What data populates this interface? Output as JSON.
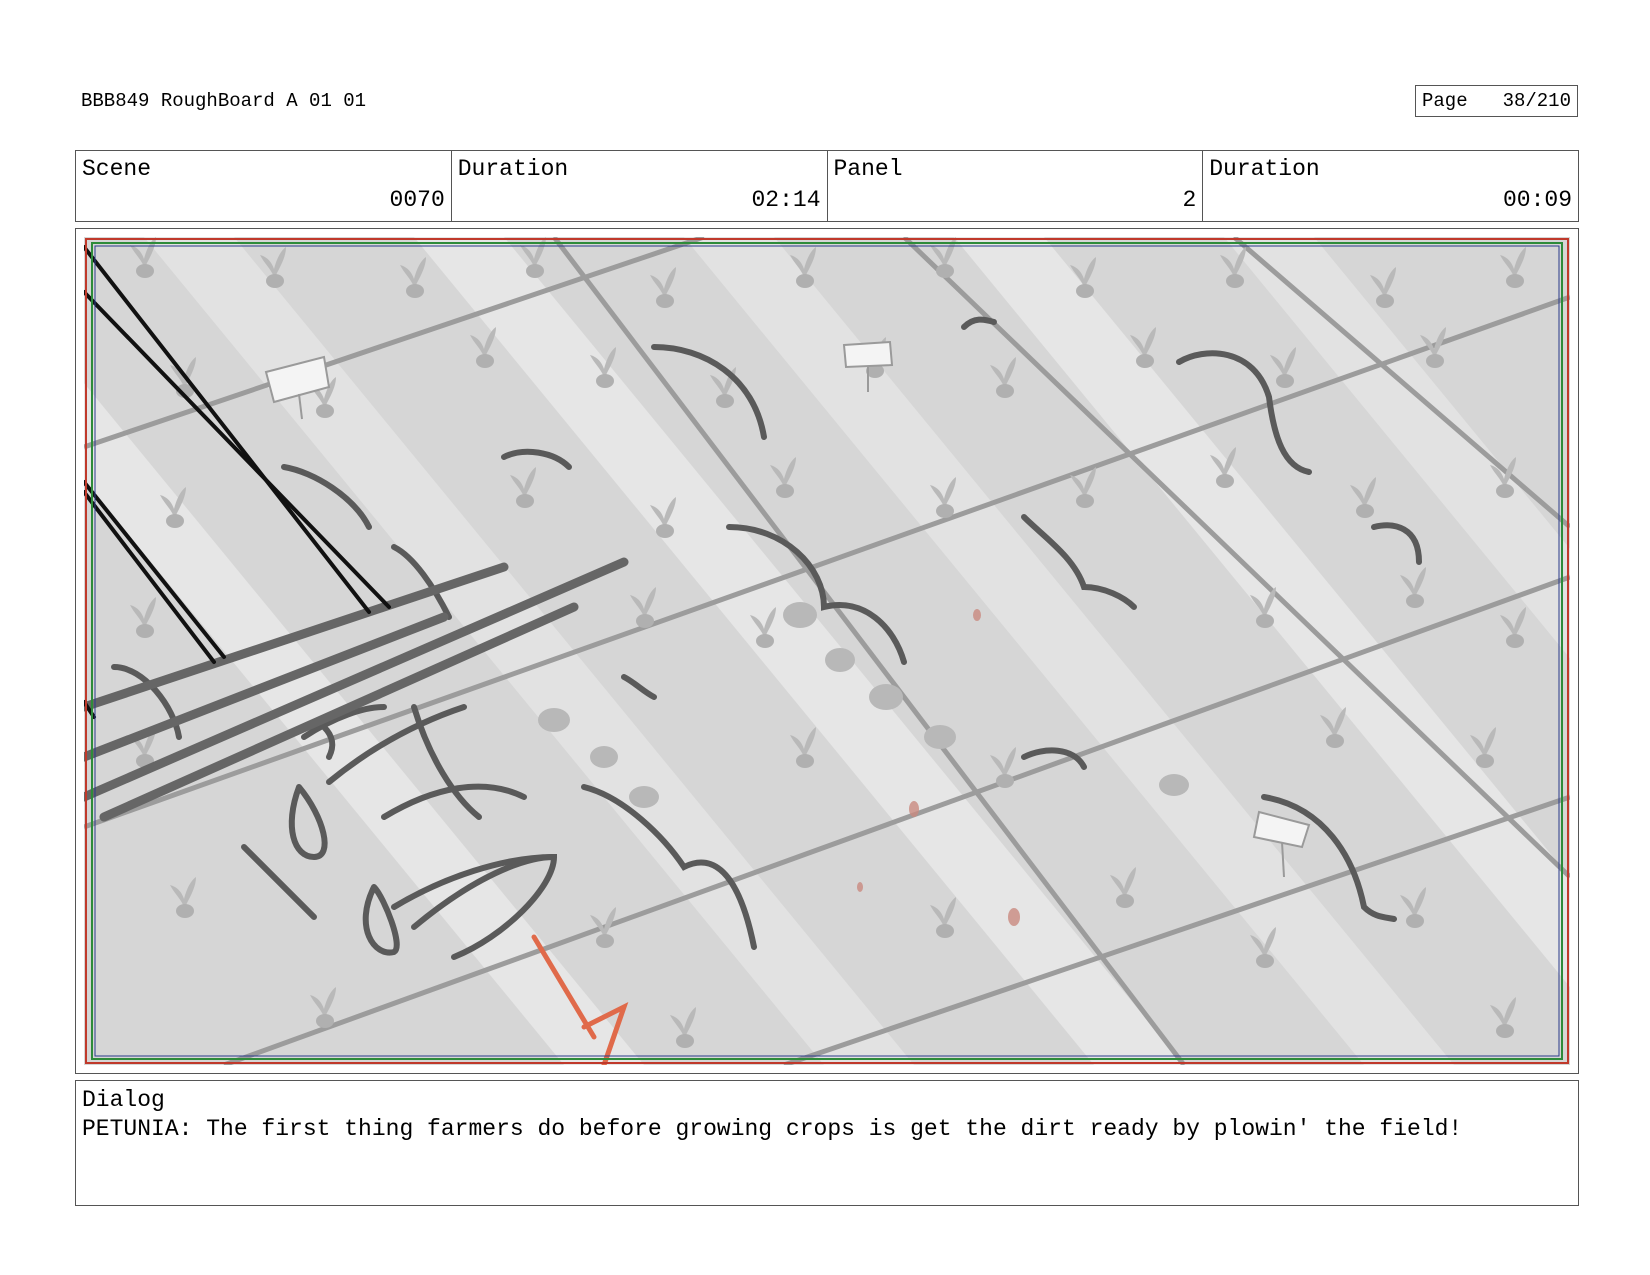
{
  "header": {
    "project": "BBB849 RoughBoard A 01 01",
    "page_label": "Page",
    "page_value": "38/210"
  },
  "info": {
    "scene_label": "Scene",
    "scene_value": "0070",
    "scene_duration_label": "Duration",
    "scene_duration_value": "02:14",
    "panel_label": "Panel",
    "panel_value": "2",
    "panel_duration_label": "Duration",
    "panel_duration_value": "00:09"
  },
  "panel": {
    "description_icon": "storyboard-sketch-image",
    "colors": {
      "field": "#d4d4d4",
      "stripe": "#e6e6e6",
      "sketch": "#5a5a5a",
      "ink": "#111111",
      "arrow": "#e06a4a",
      "safe_red": "#c0392b",
      "safe_green": "#2e8b3a"
    }
  },
  "dialog": {
    "label": "Dialog",
    "text": "PETUNIA: The first thing farmers do before growing crops is get the dirt ready by plowin' the field!"
  }
}
